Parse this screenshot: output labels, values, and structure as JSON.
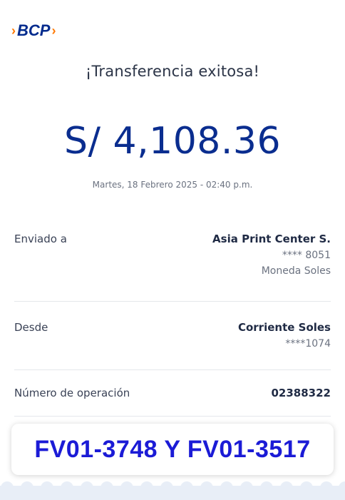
{
  "logo": {
    "text": "BCP"
  },
  "headline": "¡Transferencia exitosa!",
  "amount": "S/ 4,108.36",
  "datetime": "Martes, 18 Febrero 2025 - 02:40 p.m.",
  "sent_to": {
    "label": "Enviado a",
    "name": "Asia Print Center S.",
    "account": "**** 8051",
    "currency": "Moneda Soles"
  },
  "from": {
    "label": "Desde",
    "name": "Corriente Soles",
    "account": "****1074"
  },
  "operation": {
    "label": "Número de operación",
    "number": "02388322"
  },
  "banner": {
    "text": "FV01-3748 Y  FV01-3517"
  },
  "colors": {
    "brand_blue": "#0a2d8f",
    "brand_orange": "#ff7800",
    "banner_text": "#1b1bd6"
  }
}
